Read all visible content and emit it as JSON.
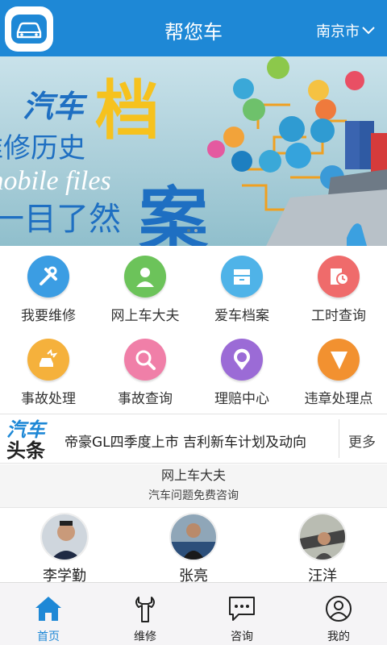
{
  "header": {
    "title": "帮您车",
    "city": "南京市"
  },
  "banner": {
    "line1": "汽车",
    "line1_big": "档",
    "line2": "维修历史",
    "line3": "mobile files",
    "line4": "一目了然",
    "line4_big": "案"
  },
  "services": [
    {
      "label": "我要维修",
      "icon": "wrench-icon",
      "color": "#3b9de3"
    },
    {
      "label": "网上车大夫",
      "icon": "doctor-icon",
      "color": "#6cc35a"
    },
    {
      "label": "爱车档案",
      "icon": "file-box-icon",
      "color": "#4fb3e8"
    },
    {
      "label": "工时查询",
      "icon": "clock-icon",
      "color": "#ef6b6b"
    },
    {
      "label": "事故处理",
      "icon": "car-crash-icon",
      "color": "#f5b13c"
    },
    {
      "label": "事故查询",
      "icon": "magnifier-icon",
      "color": "#f07fa8"
    },
    {
      "label": "理赔中心",
      "icon": "claim-pin-icon",
      "color": "#9b6bd6"
    },
    {
      "label": "违章处理点",
      "icon": "violation-icon",
      "color": "#f29130"
    }
  ],
  "news": {
    "logo_top": "汽车",
    "logo_bottom": "头条",
    "headline": "帝豪GL四季度上市 吉利新车计划及动向",
    "more": "更多"
  },
  "doctors_section": {
    "title": "网上车大夫",
    "subtitle": "汽车问题免费咨询",
    "doctors": [
      {
        "name": "李学勤"
      },
      {
        "name": "张亮"
      },
      {
        "name": "汪洋"
      }
    ]
  },
  "tabbar": {
    "tabs": [
      {
        "label": "首页",
        "icon": "home-icon"
      },
      {
        "label": "维修",
        "icon": "wrench-icon"
      },
      {
        "label": "咨询",
        "icon": "chat-icon"
      },
      {
        "label": "我的",
        "icon": "user-icon"
      }
    ],
    "active_color": "#1e88d6"
  },
  "colors": {
    "brand": "#1e88d6"
  }
}
